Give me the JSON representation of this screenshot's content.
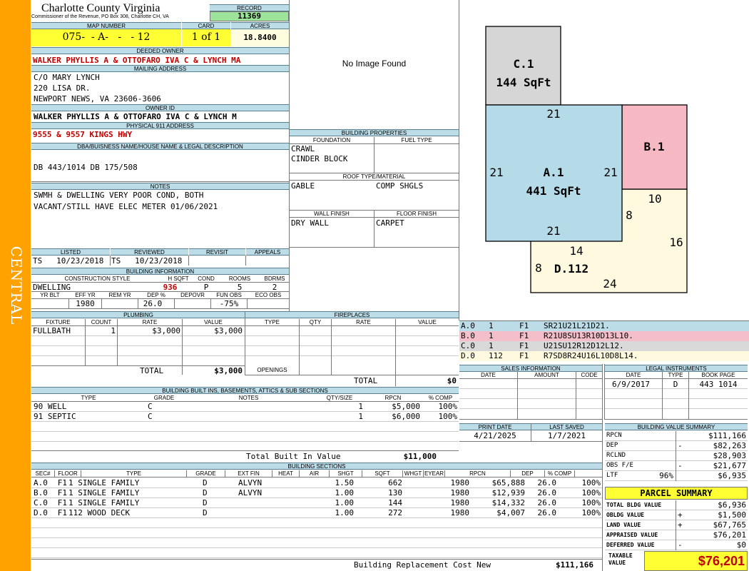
{
  "side_label": "CENTRAL",
  "header": {
    "county": "Charlotte County Virginia",
    "commissioner": "Commissioner of the Revenue, PO Box 308, Charlotte CH, VA",
    "record_label": "RECORD",
    "record": "11369",
    "map_label": "MAP NUMBER",
    "map_number": "075-  - A-   -   - 12",
    "card_label": "CARD",
    "card": "1 of 1",
    "acres_label": "ACRES",
    "acres": "18.8400"
  },
  "owner": {
    "deeded_label": "DEEDED OWNER",
    "deeded": "WALKER PHYLLIS A & OTTOFARO IVA C & LYNCH MA",
    "mailing_label": "MAILING ADDRESS",
    "mailing": [
      "C/O MARY LYNCH",
      "220 LISA DR.",
      "NEWPORT NEWS, VA 23606-3606"
    ],
    "ownerid_label": "OWNER ID",
    "ownerid": "WALKER PHYLLIS A & OTTOFARO IVA C & LYNCH M",
    "physical_label": "PHYSICAL 911 ADDRESS",
    "physical": "9555 & 9557 KINGS HWY",
    "dba_label": "DBA/BUISNESS NAME/HOUSE NAME & LEGAL DESCRIPTION",
    "dba": "DB 443/1014 DB 175/508",
    "notes_label": "NOTES",
    "notes": [
      "SWMH & DWELLING VERY POOR COND, BOTH",
      "VACANT/STILL HAVE ELEC METER 01/06/2021"
    ]
  },
  "photo": {
    "text": "No Image Found"
  },
  "bp": {
    "label": "BUILDING PROPERTIES",
    "foundation_label": "FOUNDATION",
    "fuel_label": "FUEL TYPE",
    "foundation": [
      "CRAWL",
      "CINDER BLOCK"
    ],
    "roof_label": "ROOF TYPE/MATERIAL",
    "roof_type": "GABLE",
    "roof_mat": "COMP SHGLS",
    "wall_label": "WALL FINISH",
    "floor_label": "FLOOR FINISH",
    "wall": "DRY WALL",
    "floor": "CARPET"
  },
  "dates": {
    "listed_label": "LISTED",
    "reviewed_label": "REVIEWED",
    "revisit_label": "REVISIT",
    "appeals_label": "APPEALS",
    "listed": "TS   10/23/2018",
    "reviewed": "TS   10/23/2018"
  },
  "bi": {
    "label": "BUILDING INFORMATION",
    "cs_label": "CONSTRUCTION STYLE",
    "hsqft_label": "H SQFT",
    "cond_label": "COND",
    "rooms_label": "ROOMS",
    "bdrms_label": "BDRMS",
    "style": "DWELLING",
    "hsqft": "936",
    "cond": "P",
    "rooms": "5",
    "bdrms": "2",
    "yrblt_label": "YR BLT",
    "effyr_label": "EFF YR",
    "remyr_label": "REM YR",
    "dep_label": "DEP %",
    "depovr_label": "DEPOVR",
    "funobs_label": "FUN OBS",
    "ecoobs_label": "ECO OBS",
    "effyr": "1980",
    "dep": "26.0",
    "funobs": "-75%"
  },
  "plumbing": {
    "label": "PLUMBING",
    "headers": [
      "FIXTURE",
      "COUNT",
      "RATE",
      "VALUE"
    ],
    "rows": [
      [
        "FULLBATH",
        "1",
        "$3,000",
        "$3,000"
      ]
    ],
    "total_label": "TOTAL",
    "total": "$3,000"
  },
  "fireplaces": {
    "label": "FIREPLACES",
    "headers": [
      "TYPE",
      "QTY",
      "RATE",
      "VALUE"
    ],
    "openings_label": "OPENINGS",
    "total_label": "TOTAL",
    "total": "$0"
  },
  "builtins": {
    "label": "BUILDING BUILT INS, BASEMENTS, ATTICS & SUB SECTIONS",
    "headers": [
      "TYPE",
      "GRADE",
      "NOTES",
      "QTY/SIZE",
      "RPCN",
      "% COMP"
    ],
    "rows": [
      [
        "90 WELL",
        "C",
        "",
        "1",
        "$5,000",
        "100%"
      ],
      [
        "91 SEPTIC",
        "C",
        "",
        "1",
        "$6,000",
        "100%"
      ]
    ],
    "total_label": "Total Built In Value",
    "total": "$11,000"
  },
  "sections": {
    "label": "BUILDING SECTIONS",
    "headers": [
      "SEC#",
      "FLOOR",
      "TYPE",
      "GRADE",
      "EXT FIN",
      "HEAT",
      "AIR",
      "SHGT",
      "SQFT",
      "WHGT",
      "EYEAR",
      "RPCN",
      "DEP",
      "% COMP"
    ],
    "rows": [
      [
        "A.0",
        "F1",
        "1 SINGLE FAMILY",
        "D",
        "ALVYN",
        "",
        "",
        "1.50",
        "662",
        "",
        "1980",
        "$65,888",
        "26.0",
        "100%"
      ],
      [
        "B.0",
        "F1",
        "1 SINGLE FAMILY",
        "D",
        "ALVYN",
        "",
        "",
        "1.00",
        "130",
        "",
        "1980",
        "$12,939",
        "26.0",
        "100%"
      ],
      [
        "C.0",
        "F1",
        "1 SINGLE FAMILY",
        "D",
        "",
        "",
        "",
        "1.00",
        "144",
        "",
        "1980",
        "$14,332",
        "26.0",
        "100%"
      ],
      [
        "D.0",
        "F1",
        "112 WOOD DECK",
        "D",
        "",
        "",
        "",
        "1.00",
        "272",
        "",
        "1980",
        "$4,007",
        "26.0",
        "100%"
      ]
    ],
    "brcn_label": "Building Replacement Cost New",
    "brcn": "$111,166"
  },
  "sketch": {
    "c_name": "C.1",
    "c_area": "144 SqFt",
    "a_name": "A.1",
    "a_area": "441 SqFt",
    "b_name": "B.1",
    "d_name": "D.112",
    "dims": {
      "a_top": "21",
      "a_left": "21",
      "a_right": "21",
      "a_bottom": "21",
      "b_10": "10",
      "b_8": "8",
      "d_16": "16",
      "d_14": "14",
      "d_8": "8",
      "d_24": "24"
    },
    "rows": [
      {
        "sec": "A.0",
        "n": "1",
        "f": "F1",
        "code": "SR21U21L21D21.",
        "color": "#bcdce8"
      },
      {
        "sec": "B.0",
        "n": "1",
        "f": "F1",
        "code": "R21U8SU13R10D13L10.",
        "color": "#f4bfca"
      },
      {
        "sec": "C.0",
        "n": "1",
        "f": "F1",
        "code": "U21SU12R12D12L12.",
        "color": "#d9d9d9"
      },
      {
        "sec": "D.0",
        "n": "112",
        "f": "F1",
        "code": "R7SD8R24U16L10D8L14.",
        "color": "#fffadf"
      }
    ],
    "colors": {
      "a": "#b4dbe7",
      "b": "#f6b8c3",
      "c": "#d6d6d6",
      "d": "#fffadf"
    }
  },
  "sales": {
    "label": "SALES INFORMATION",
    "headers": [
      "DATE",
      "AMOUNT",
      "CODE"
    ]
  },
  "legal": {
    "label": "LEGAL INSTRUMENTS",
    "headers": [
      "DATE",
      "TYPE",
      "BOOK PAGE"
    ],
    "date": "6/9/2017",
    "type": "D",
    "book": "443 1014"
  },
  "print": {
    "pd_label": "PRINT DATE",
    "ls_label": "LAST SAVED",
    "pd": "4/21/2025",
    "ls": "1/7/2021"
  },
  "bvs": {
    "label": "BUILDING VALUE SUMMARY",
    "rows": [
      [
        "RPCN",
        "",
        "$111,166"
      ],
      [
        "DEP",
        "-",
        "$82,263"
      ],
      [
        "RCLND",
        "",
        "$28,903"
      ],
      [
        "OBS F/E",
        "-",
        "$21,677"
      ],
      [
        "LTF",
        "96%",
        "$6,935"
      ]
    ]
  },
  "parcel": {
    "label": "PARCEL SUMMARY",
    "rows": [
      [
        "TOTAL BLDG VALUE",
        "",
        "$6,936"
      ],
      [
        "OBLDG VALUE",
        "+",
        "$1,500"
      ],
      [
        "LAND VALUE",
        "+",
        "$67,765"
      ],
      [
        "APPRAISED VALUE",
        "",
        "$76,201"
      ],
      [
        "DEFERRED VALUE",
        "-",
        "$0"
      ]
    ],
    "taxable_label": "TAXABLE VALUE",
    "taxable": "$76,201"
  }
}
